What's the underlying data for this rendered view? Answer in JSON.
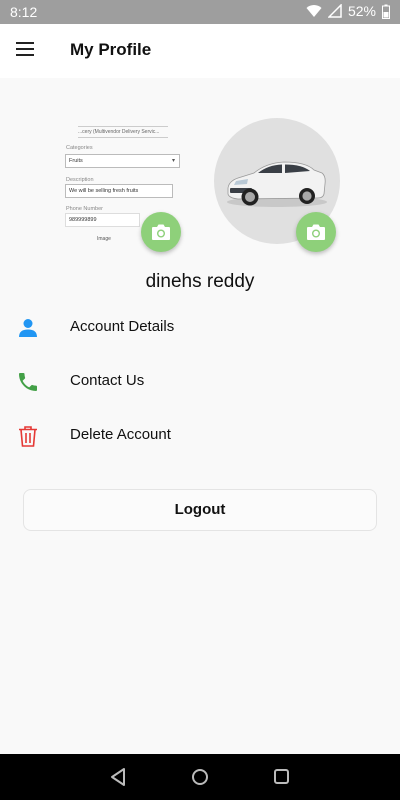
{
  "status_bar": {
    "time": "8:12",
    "battery": "52%",
    "icons": [
      "wifi-icon",
      "cellular-signal-icon",
      "battery-icon"
    ]
  },
  "app_bar": {
    "title": "My Profile",
    "menu_icon": "hamburger-menu-icon"
  },
  "profile": {
    "form_preview": {
      "header": "...cery (Multivendor Delivery Servic...",
      "categories_label": "Categories",
      "categories_value": "Fruits",
      "description_label": "Description",
      "description_value": "We will be selling fresh fruits",
      "phone_label": "Phone Number",
      "phone_value": "989999899",
      "bottom_text": "Image"
    },
    "camera_icon": "camera-icon",
    "name": "dinehs reddy"
  },
  "menu": {
    "items": [
      {
        "label": "Account Details",
        "icon": "person-icon",
        "color": "#2196f3"
      },
      {
        "label": "Contact Us",
        "icon": "phone-icon",
        "color": "#43a047"
      },
      {
        "label": "Delete Account",
        "icon": "trash-icon",
        "color": "#e53935"
      }
    ]
  },
  "logout": {
    "label": "Logout"
  },
  "colors": {
    "camera_button": "#8ed07a",
    "status_bar": "#9e9e9e",
    "nav_bar": "#000000"
  },
  "nav_bar": {
    "icons": [
      "back-icon",
      "home-icon",
      "recent-apps-icon"
    ]
  }
}
